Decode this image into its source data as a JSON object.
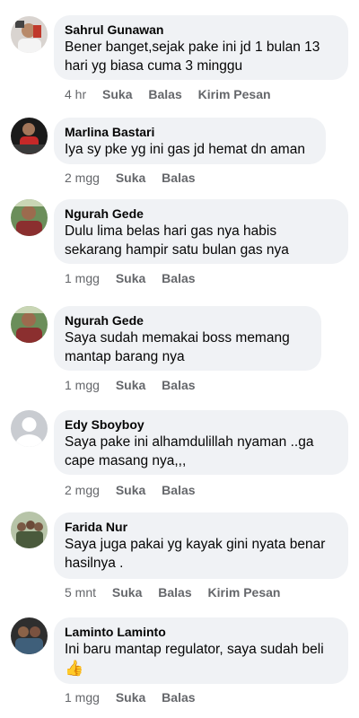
{
  "comments": [
    {
      "author": "Sahrul Gunawan",
      "text": "Bener banget,sejak pake ini jd 1 bulan 13\nhari yg biasa cuma 3 minggu",
      "time": "4 hr",
      "like": "Suka",
      "reply": "Balas",
      "message": "Kirim Pesan"
    },
    {
      "author": "Marlina Bastari",
      "text": "Iya sy pke yg ini gas jd hemat dn aman",
      "time": "2 mgg",
      "like": "Suka",
      "reply": "Balas"
    },
    {
      "author": "Ngurah Gede",
      "text": "Dulu lima belas hari gas nya habis\nsekarang hampir satu bulan gas nya",
      "time": "1 mgg",
      "like": "Suka",
      "reply": "Balas"
    },
    {
      "author": "Ngurah Gede",
      "text": "Saya sudah memakai boss memang\nmantap barang nya",
      "time": "1 mgg",
      "like": "Suka",
      "reply": "Balas"
    },
    {
      "author": "Edy Sboyboy",
      "text": "Saya pake ini alhamdulillah nyaman ..ga\ncape masang nya,,,",
      "time": "2 mgg",
      "like": "Suka",
      "reply": "Balas"
    },
    {
      "author": "Farida Nur",
      "text": "Saya juga pakai yg kayak gini nyata benar\nhasilnya .",
      "time": "5 mnt",
      "like": "Suka",
      "reply": "Balas",
      "message": "Kirim Pesan"
    },
    {
      "author": "Laminto Laminto",
      "text": "Ini baru mantap regulator, saya sudah beli",
      "emoji": "👍",
      "time": "1 mgg",
      "like": "Suka",
      "reply": "Balas"
    }
  ],
  "avatars": [
    "profile-photo-icon",
    "profile-photo-icon",
    "profile-photo-icon",
    "profile-photo-icon",
    "default-avatar-icon",
    "profile-photo-icon",
    "profile-photo-icon"
  ],
  "colors": {
    "bubble": "#f0f2f5",
    "meta_text": "#65676b",
    "body_text": "#050505"
  }
}
